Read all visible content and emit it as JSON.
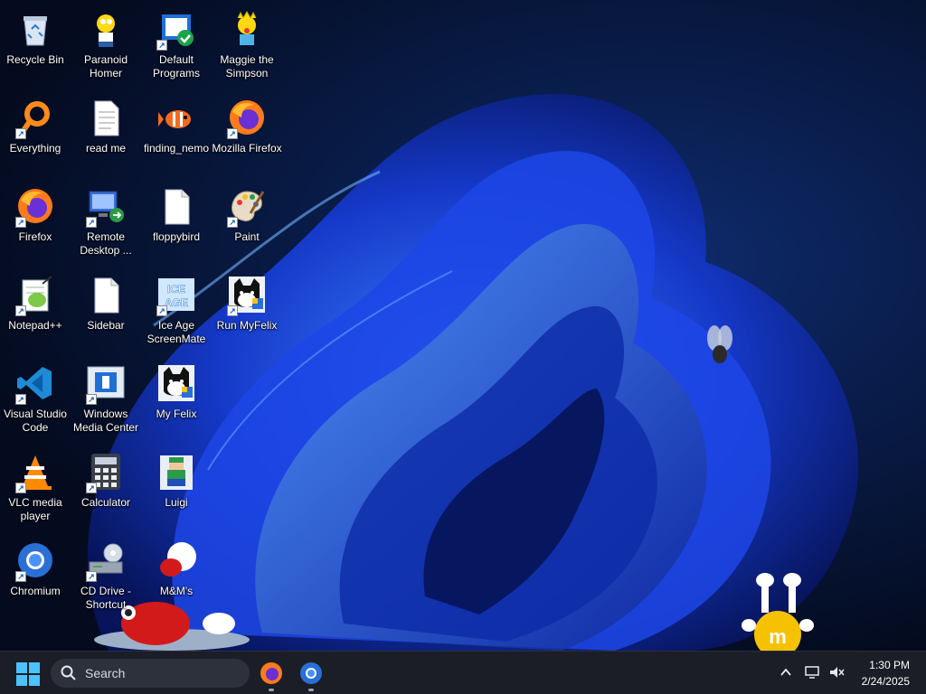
{
  "desktop": {
    "icons": [
      {
        "label": "Recycle Bin",
        "icon": "recycle-bin-icon",
        "shortcut": false
      },
      {
        "label": "Paranoid Homer",
        "icon": "homer-icon",
        "shortcut": false
      },
      {
        "label": "Default Programs",
        "icon": "default-programs-icon",
        "shortcut": true
      },
      {
        "label": "Maggie the Simpson",
        "icon": "maggie-icon",
        "shortcut": false
      },
      {
        "label": "Everything",
        "icon": "everything-search-icon",
        "shortcut": true
      },
      {
        "label": "read me",
        "icon": "text-document-icon",
        "shortcut": false
      },
      {
        "label": "finding_nemo",
        "icon": "nemo-fish-icon",
        "shortcut": false
      },
      {
        "label": "Mozilla Firefox",
        "icon": "firefox-icon",
        "shortcut": true
      },
      {
        "label": "Firefox",
        "icon": "firefox-icon",
        "shortcut": true
      },
      {
        "label": "Remote Desktop ...",
        "icon": "remote-desktop-icon",
        "shortcut": true
      },
      {
        "label": "floppybird",
        "icon": "blank-document-icon",
        "shortcut": false
      },
      {
        "label": "Paint",
        "icon": "paint-palette-icon",
        "shortcut": true
      },
      {
        "label": "Notepad++",
        "icon": "notepad-plus-plus-icon",
        "shortcut": true
      },
      {
        "label": "Sidebar",
        "icon": "blank-document-icon",
        "shortcut": false
      },
      {
        "label": "Ice Age ScreenMate",
        "icon": "ice-age-icon",
        "shortcut": true
      },
      {
        "label": "Run MyFelix",
        "icon": "felix-cat-icon",
        "shortcut": true
      },
      {
        "label": "Visual Studio Code",
        "icon": "vscode-icon",
        "shortcut": true
      },
      {
        "label": "Windows Media Center",
        "icon": "media-center-icon",
        "shortcut": true
      },
      {
        "label": "My Felix",
        "icon": "felix-cat-icon",
        "shortcut": false
      },
      {
        "label": "VLC media player",
        "icon": "vlc-cone-icon",
        "shortcut": true
      },
      {
        "label": "Calculator",
        "icon": "calculator-icon",
        "shortcut": true
      },
      {
        "label": "Luigi",
        "icon": "luigi-icon",
        "shortcut": false
      },
      {
        "label": "Chromium",
        "icon": "chromium-icon",
        "shortcut": true
      },
      {
        "label": "CD Drive - Shortcut",
        "icon": "cd-drive-icon",
        "shortcut": true
      },
      {
        "label": "M&M's",
        "icon": "mms-icon",
        "shortcut": false
      }
    ]
  },
  "taskbar": {
    "search_label": "Search",
    "time": "1:30 PM",
    "date": "2/24/2025",
    "apps": [
      {
        "name": "firefox-taskbar-button",
        "icon": "firefox-icon"
      },
      {
        "name": "chromium-taskbar-button",
        "icon": "chromium-icon"
      }
    ],
    "accent": "#4cc2ff"
  },
  "colors": {
    "wallpaper_bg": "#06122e",
    "bloom_blue": "#1f4de0",
    "taskbar_bg": "#1b1e26"
  }
}
